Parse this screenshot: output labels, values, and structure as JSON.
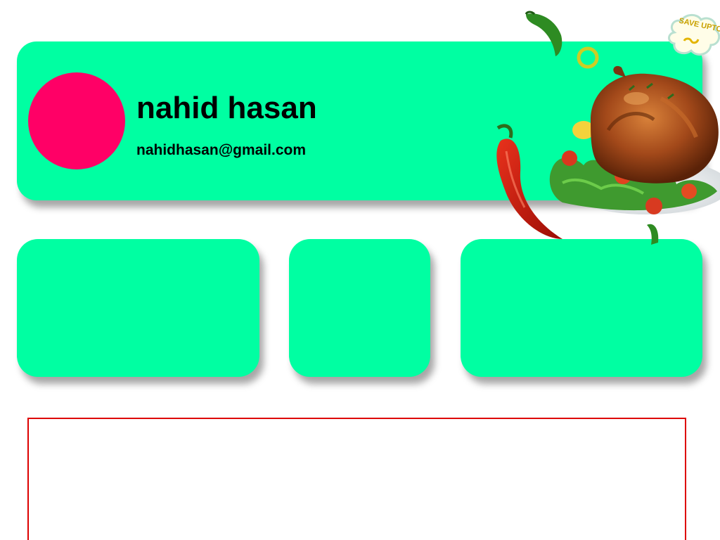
{
  "profile": {
    "name": "nahid hasan",
    "email": "nahidhasan@gmail.com"
  },
  "promo": {
    "text": "SAVE UPTO"
  },
  "colors": {
    "card_green": "#00FFA2",
    "avatar_pink": "#FF0066",
    "content_border": "#DD0000",
    "chili_red": "#C8140C",
    "chili_green": "#2E8B22"
  },
  "icons": {
    "food": "roast-chicken-icon",
    "chili": "chili-pepper-icon",
    "promo": "promo-cloud-icon"
  }
}
